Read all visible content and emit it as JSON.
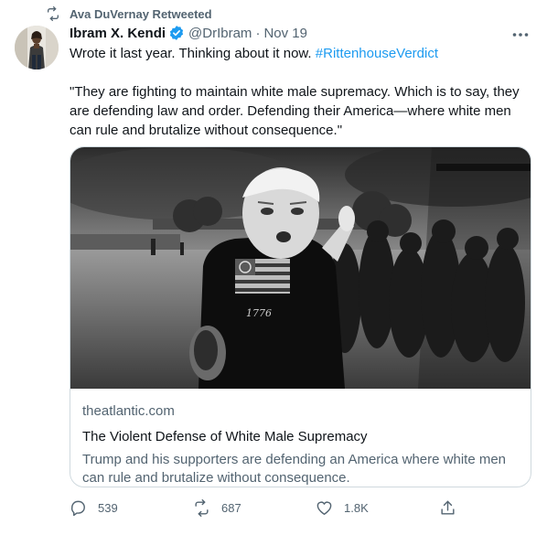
{
  "retweet": {
    "label": "Ava DuVernay Retweeted",
    "icon": "retweet-icon"
  },
  "author": {
    "name": "Ibram X. Kendi",
    "handle": "@DrIbram",
    "separator": "·",
    "date": "Nov 19",
    "verified_icon": "verified-badge-icon"
  },
  "tweet": {
    "text": "Wrote it last year. Thinking about it now. ",
    "hashtag": "#RittenhouseVerdict",
    "quote": "\"They are fighting to maintain white male supremacy. Which is to say, they are defending law and order. Defending their America—where white men can rule and brutalize without consequence.\""
  },
  "card": {
    "domain": "theatlantic.com",
    "title": "The Violent Defense of White Male Supremacy",
    "description": "Trump and his supporters are defending an America where white men can rule and brutalize without consequence.",
    "image_text": "1776"
  },
  "actions": {
    "reply_count": "539",
    "retweet_count": "687",
    "like_count": "1.8K"
  },
  "colors": {
    "accent": "#1d9bf0",
    "secondary_text": "#536471",
    "border": "#cfd9de"
  }
}
